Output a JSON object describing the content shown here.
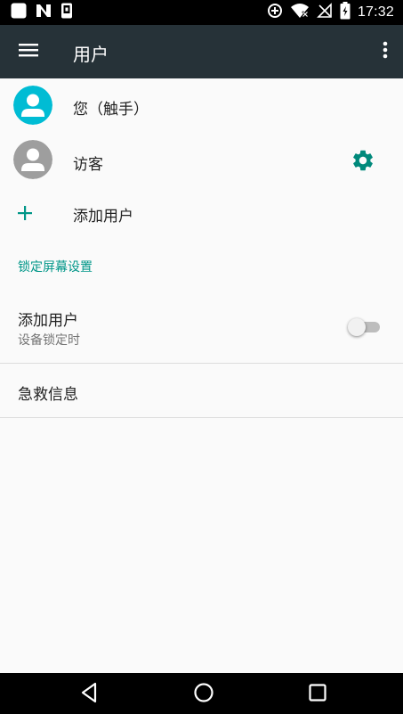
{
  "status_bar": {
    "time": "17:32",
    "left_icons": [
      "app-icon",
      "n-notification-icon",
      "phone-notification-icon"
    ],
    "right_icons": [
      "data-saver-icon",
      "wifi-icon",
      "no-signal-icon",
      "battery-icon"
    ]
  },
  "app_bar": {
    "title": "用户",
    "menu_icon": "hamburger-menu-icon",
    "more_icon": "more-vertical-icon",
    "color": "#263238"
  },
  "users": [
    {
      "name": "您（触手）",
      "avatar_color": "#00bcd4",
      "has_settings": false
    },
    {
      "name": "访客",
      "avatar_color": "#9e9e9e",
      "has_settings": true
    }
  ],
  "add_user_row": {
    "label": "添加用户",
    "icon": "plus-icon"
  },
  "lock_screen_section": {
    "header": "锁定屏幕设置",
    "accent": "#009688",
    "add_users_pref": {
      "title": "添加用户",
      "subtitle": "设备锁定时",
      "enabled": false
    }
  },
  "emergency_info": {
    "label": "急救信息"
  },
  "nav_bar": {
    "icons": [
      "back-icon",
      "home-icon",
      "recents-icon"
    ]
  }
}
